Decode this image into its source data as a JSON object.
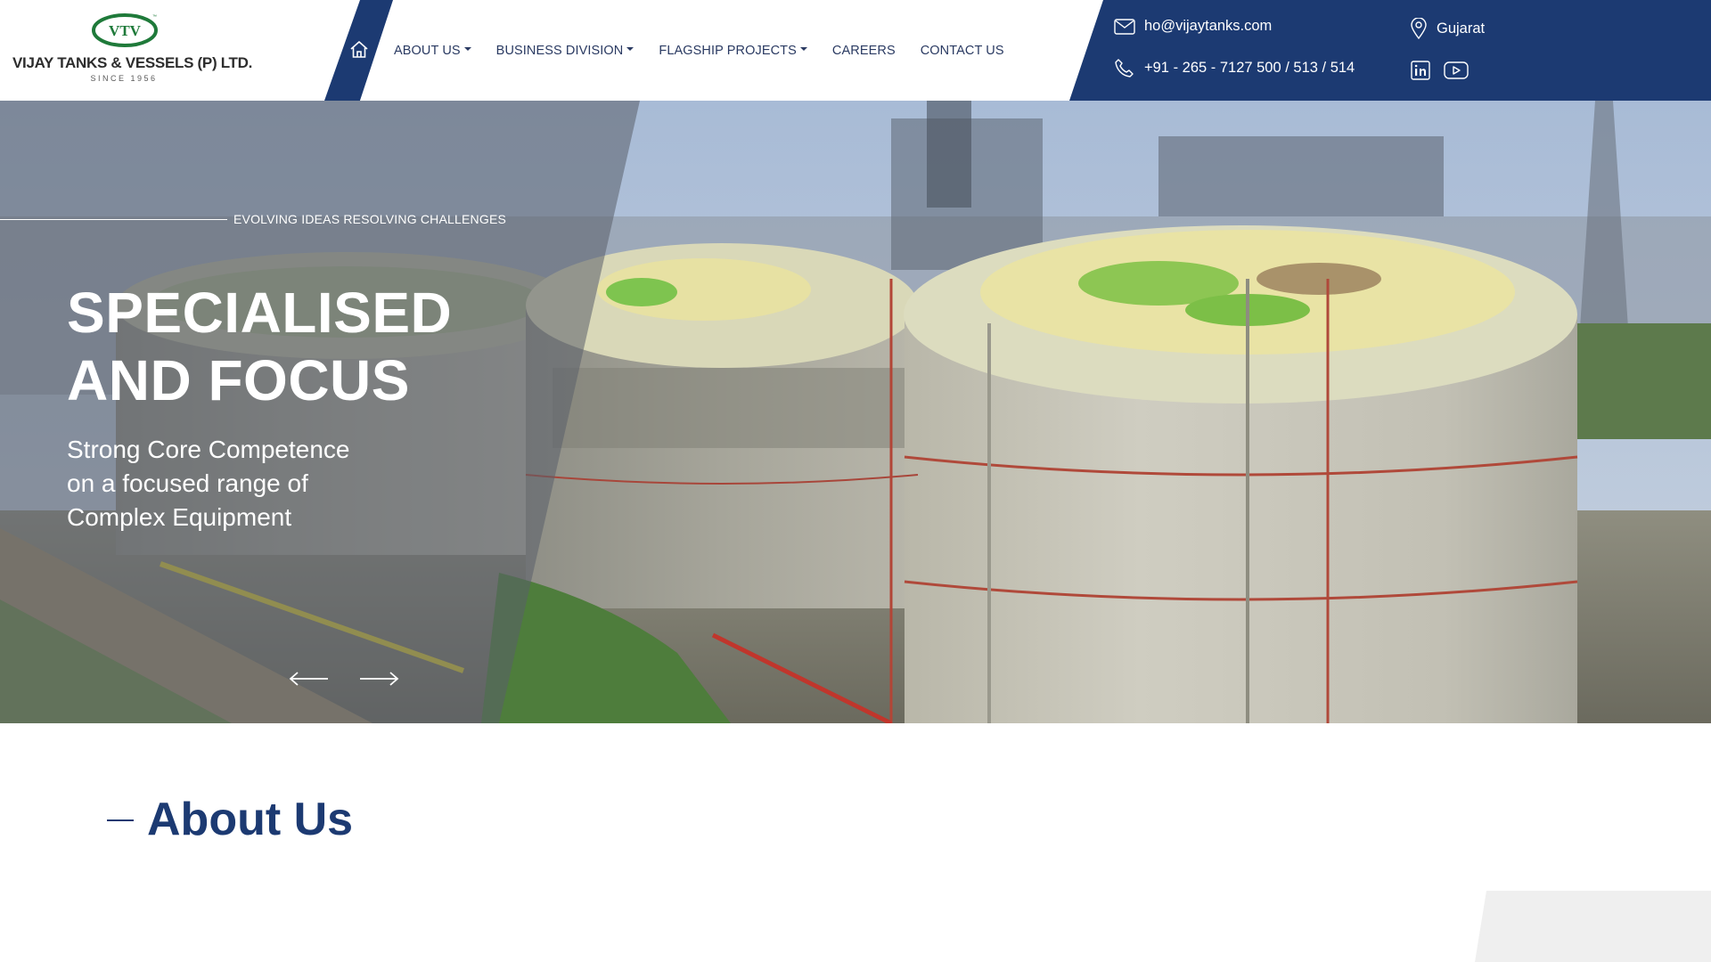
{
  "brand": {
    "emblem_text": "VTV",
    "name": "VIJAY TANKS & VESSELS (P) LTD.",
    "since": "SINCE 1956",
    "green": "#1f7a3a"
  },
  "colors": {
    "navy": "#1c3a72",
    "nav_text": "#2a3a62"
  },
  "nav": {
    "home_icon": "home-icon",
    "items": [
      {
        "label": "ABOUT US",
        "dropdown": true
      },
      {
        "label": "BUSINESS DIVISION",
        "dropdown": true
      },
      {
        "label": "FLAGSHIP PROJECTS",
        "dropdown": true
      },
      {
        "label": "CAREERS",
        "dropdown": false
      },
      {
        "label": "CONTACT US",
        "dropdown": false
      }
    ]
  },
  "contact": {
    "email": "ho@vijaytanks.com",
    "phone": "+91 - 265 - 7127 500 / 513 / 514",
    "location": "Gujarat",
    "social": [
      "linkedin-icon",
      "youtube-icon"
    ]
  },
  "hero": {
    "tagline": "EVOLVING IDEAS RESOLVING CHALLENGES",
    "title_line1": "SPECIALISED",
    "title_line2": "AND FOCUS",
    "subtitle_line1": "Strong Core Competence",
    "subtitle_line2": "on a focused range of",
    "subtitle_line3": "Complex Equipment"
  },
  "about": {
    "heading": "About Us"
  }
}
